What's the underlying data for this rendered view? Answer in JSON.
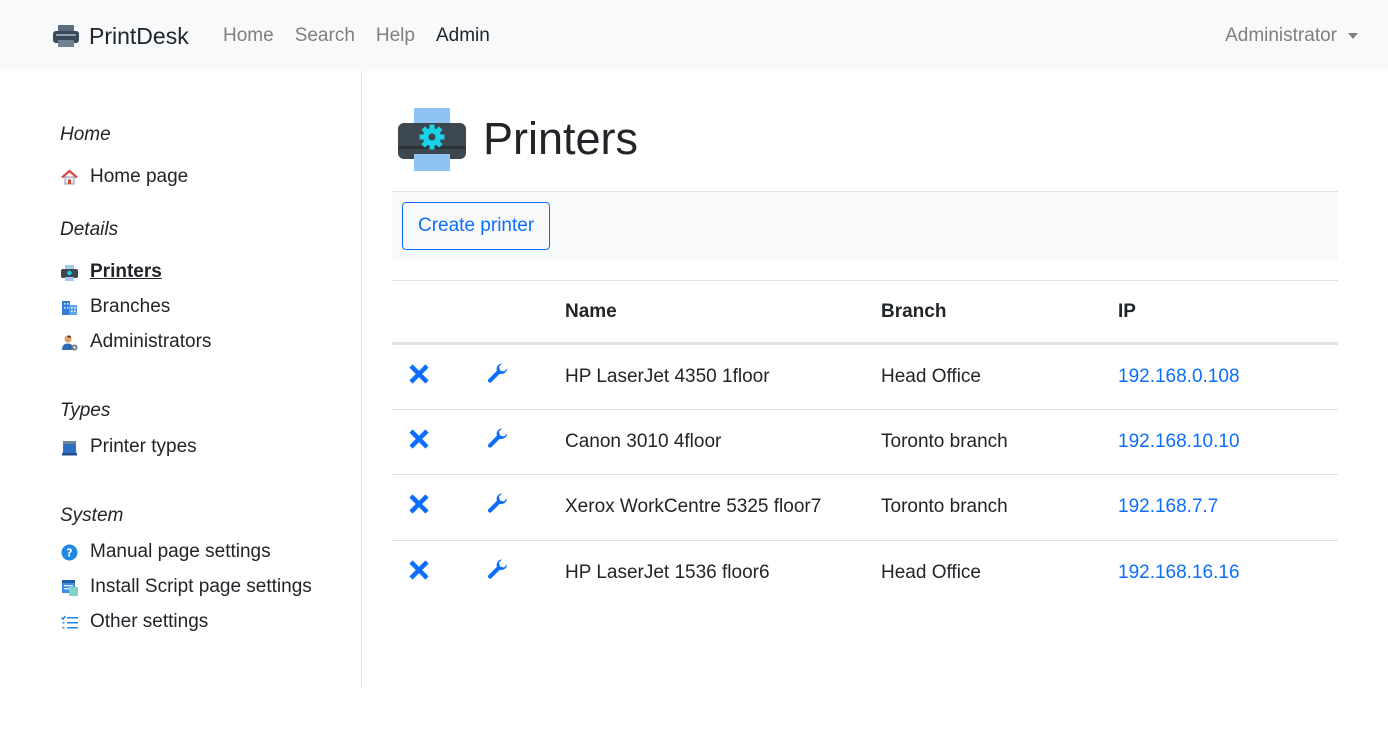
{
  "navbar": {
    "brand": "PrintDesk",
    "links": [
      {
        "label": "Home",
        "active": false
      },
      {
        "label": "Search",
        "active": false
      },
      {
        "label": "Help",
        "active": false
      },
      {
        "label": "Admin",
        "active": true
      }
    ],
    "user": "Administrator"
  },
  "sidebar": {
    "sections": [
      {
        "title": "Home",
        "items": [
          {
            "label": "Home page",
            "icon": "house-icon"
          }
        ]
      },
      {
        "title": "Details",
        "items": [
          {
            "label": "Printers",
            "icon": "printer-icon",
            "current": true
          },
          {
            "label": "Branches",
            "icon": "building-icon"
          },
          {
            "label": "Administrators",
            "icon": "admin-user-icon"
          }
        ]
      },
      {
        "title": "Types",
        "items": [
          {
            "label": "Printer types",
            "icon": "printer-type-icon"
          }
        ]
      },
      {
        "title": "System",
        "items": [
          {
            "label": "Manual page settings",
            "icon": "help-icon"
          },
          {
            "label": "Install Script page settings",
            "icon": "script-icon"
          },
          {
            "label": "Other settings",
            "icon": "checklist-icon"
          }
        ]
      }
    ]
  },
  "main": {
    "title": "Printers",
    "create_button": "Create printer",
    "table": {
      "headers": [
        "",
        "",
        "Name",
        "Branch",
        "IP"
      ],
      "rows": [
        {
          "name": "HP LaserJet 4350 1floor",
          "branch": "Head Office",
          "ip": "192.168.0.108"
        },
        {
          "name": "Canon 3010 4floor",
          "branch": "Toronto branch",
          "ip": "192.168.10.10"
        },
        {
          "name": "Xerox WorkCentre 5325 floor7",
          "branch": "Toronto branch",
          "ip": "192.168.7.7"
        },
        {
          "name": "HP LaserJet 1536 floor6",
          "branch": "Head Office",
          "ip": "192.168.16.16"
        }
      ]
    }
  },
  "colors": {
    "accent": "#0d6efd",
    "navbar_bg": "#f8f9fa",
    "muted_text": "#7d7f81",
    "border": "#dee2e6"
  }
}
